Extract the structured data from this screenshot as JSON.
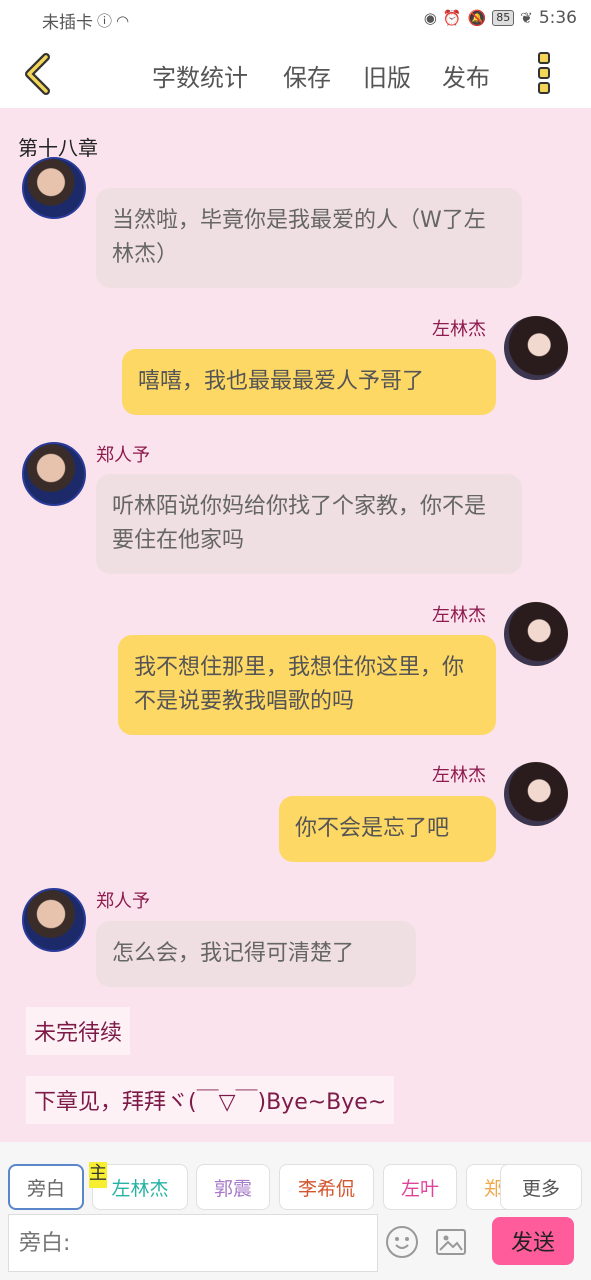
{
  "status_bar": {
    "carrier": "未插卡",
    "battery": "85",
    "time": "5:36"
  },
  "toolbar": {
    "word_count": "字数统计",
    "save": "保存",
    "old_version": "旧版",
    "publish": "发布"
  },
  "chapter_title": "第十八章",
  "messages": [
    {
      "side": "left",
      "name": "",
      "text": "当然啦，毕竟你是我最爱的人（W了左林杰）"
    },
    {
      "side": "right",
      "name": "左林杰",
      "text": "嘻嘻，我也最最最爱人予哥了"
    },
    {
      "side": "left",
      "name": "郑人予",
      "text": "听林陌说你妈给你找了个家教，你不是要住在他家吗"
    },
    {
      "side": "right",
      "name": "左林杰",
      "text": "我不想住那里，我想住你这里，你不是说要教我唱歌的吗"
    },
    {
      "side": "right",
      "name": "左林杰",
      "text": "你不会是忘了吧"
    },
    {
      "side": "left",
      "name": "郑人予",
      "text": "怎么会，我记得可清楚了"
    }
  ],
  "narration": [
    "未完待续",
    "下章见，拜拜ヾ(￣▽￣)Bye~Bye~"
  ],
  "roles": {
    "main_badge": "主",
    "chips": [
      {
        "label": "旁白",
        "color": "#666666"
      },
      {
        "label": "左林杰",
        "color": "#26b3a6"
      },
      {
        "label": "郭震",
        "color": "#a77bc8"
      },
      {
        "label": "李希侃",
        "color": "#d2552d"
      },
      {
        "label": "左叶",
        "color": "#e0449a"
      },
      {
        "label": "郑",
        "color": "#f0a94a"
      }
    ],
    "more": "更多"
  },
  "composer": {
    "placeholder": "旁白:",
    "send": "发送"
  },
  "colors": {
    "accent_yellow": "#fdd865",
    "send_pink": "#ff5c9c",
    "name_color": "#8e1a4e",
    "background": "#fae3ec"
  }
}
